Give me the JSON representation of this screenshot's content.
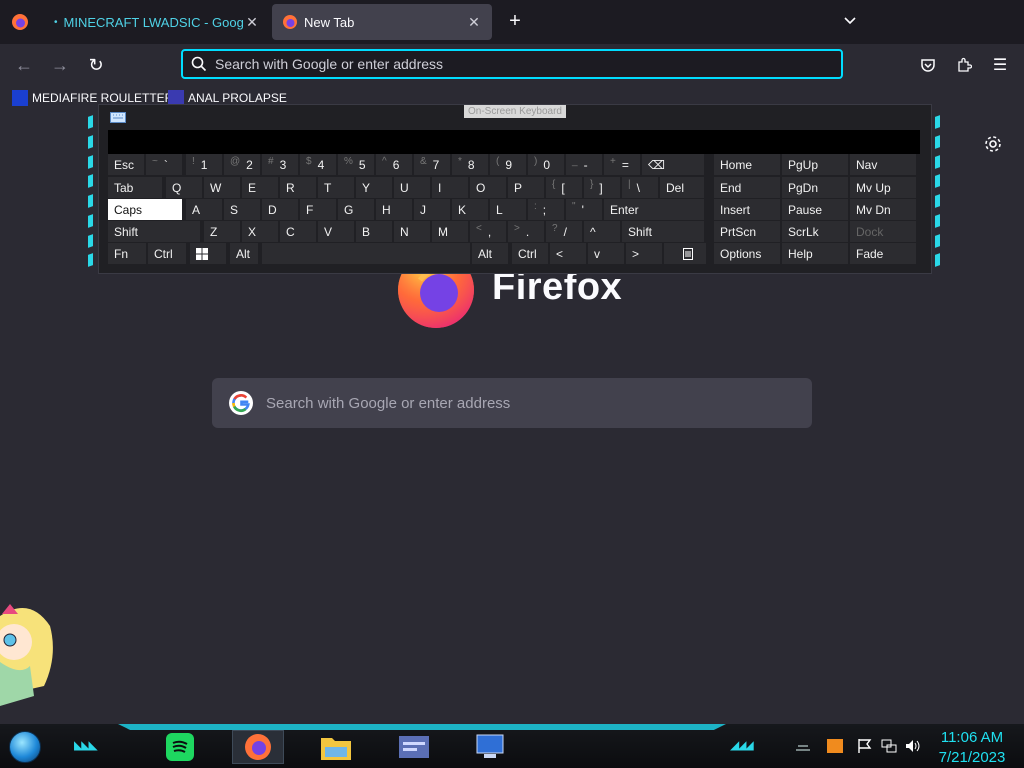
{
  "tabs": [
    {
      "label": "MINECRAFT LWADSIC - Google",
      "active": false,
      "close": "✕"
    },
    {
      "label": "New Tab",
      "active": true,
      "close": "✕"
    }
  ],
  "tabstrip": {
    "new_tab": "+",
    "list_all_tabs": "⌄"
  },
  "navbar": {
    "back": "←",
    "forward": "→",
    "reload": "↻",
    "urlbar_placeholder": "Search with Google or enter address",
    "pocket": "pocket-icon",
    "extensions": "extensions-icon",
    "menu": "☰"
  },
  "bookmarks": [
    {
      "label": "MEDIAFIRE ROULETTER",
      "icon": "mft-icon"
    },
    {
      "label": "ANAL PROLAPSE",
      "icon": "bookmark-icon"
    }
  ],
  "newtab": {
    "wordmark": "Firefox",
    "search_placeholder": "Search with Google or enter address"
  },
  "osk": {
    "title": "On-Screen Keyboard",
    "rows": [
      [
        {
          "label": "Esc"
        },
        {
          "shift": "~",
          "label": "`"
        },
        {
          "shift": "!",
          "label": "1"
        },
        {
          "shift": "@",
          "label": "2"
        },
        {
          "shift": "#",
          "label": "3"
        },
        {
          "shift": "$",
          "label": "4"
        },
        {
          "shift": "%",
          "label": "5"
        },
        {
          "shift": "^",
          "label": "6"
        },
        {
          "shift": "&",
          "label": "7"
        },
        {
          "shift": "*",
          "label": "8"
        },
        {
          "shift": "(",
          "label": "9"
        },
        {
          "shift": ")",
          "label": "0"
        },
        {
          "shift": "_",
          "label": "-"
        },
        {
          "shift": "+",
          "label": "="
        },
        {
          "label": "⌫"
        }
      ],
      [
        {
          "label": "Tab"
        },
        {
          "label": "Q"
        },
        {
          "label": "W"
        },
        {
          "label": "E"
        },
        {
          "label": "R"
        },
        {
          "label": "T"
        },
        {
          "label": "Y"
        },
        {
          "label": "U"
        },
        {
          "label": "I"
        },
        {
          "label": "O"
        },
        {
          "label": "P"
        },
        {
          "shift": "{",
          "label": "["
        },
        {
          "shift": "}",
          "label": "]"
        },
        {
          "shift": "|",
          "label": "\\"
        },
        {
          "label": "Del"
        }
      ],
      [
        {
          "label": "Caps"
        },
        {
          "label": "A"
        },
        {
          "label": "S"
        },
        {
          "label": "D"
        },
        {
          "label": "F"
        },
        {
          "label": "G"
        },
        {
          "label": "H"
        },
        {
          "label": "J"
        },
        {
          "label": "K"
        },
        {
          "label": "L"
        },
        {
          "shift": ":",
          "label": ";"
        },
        {
          "shift": "\"",
          "label": "'"
        },
        {
          "label": "Enter"
        }
      ],
      [
        {
          "label": "Shift"
        },
        {
          "label": "Z"
        },
        {
          "label": "X"
        },
        {
          "label": "C"
        },
        {
          "label": "V"
        },
        {
          "label": "B"
        },
        {
          "label": "N"
        },
        {
          "label": "M"
        },
        {
          "shift": "<",
          "label": ","
        },
        {
          "shift": ">",
          "label": "."
        },
        {
          "shift": "?",
          "label": "/"
        },
        {
          "label": "^"
        },
        {
          "label": "Shift"
        }
      ],
      [
        {
          "label": "Fn"
        },
        {
          "label": "Ctrl"
        },
        {
          "label": "win-icon"
        },
        {
          "label": "Alt"
        },
        {
          "label": ""
        },
        {
          "label": "Alt"
        },
        {
          "label": "Ctrl"
        },
        {
          "label": "<"
        },
        {
          "label": "v"
        },
        {
          "label": ">"
        },
        {
          "label": "menu-icon"
        }
      ]
    ],
    "nav_keys": [
      [
        "Home",
        "PgUp",
        "Nav"
      ],
      [
        "End",
        "PgDn",
        "Mv Up"
      ],
      [
        "Insert",
        "Pause",
        "Mv Dn"
      ],
      [
        "PrtScn",
        "ScrLk",
        "Dock"
      ],
      [
        "Options",
        "Help",
        "Fade"
      ]
    ]
  },
  "taskbar": {
    "apps": [
      "spotify-icon",
      "firefox-icon",
      "file-explorer-icon",
      "media-icon",
      "remote-desktop-icon"
    ],
    "clock_time": "11:06 AM",
    "clock_date": "7/21/2023"
  },
  "colors": {
    "accent": "#00ddff",
    "taskbar_accent": "#1db3c6",
    "clock": "#1fe0f0"
  }
}
